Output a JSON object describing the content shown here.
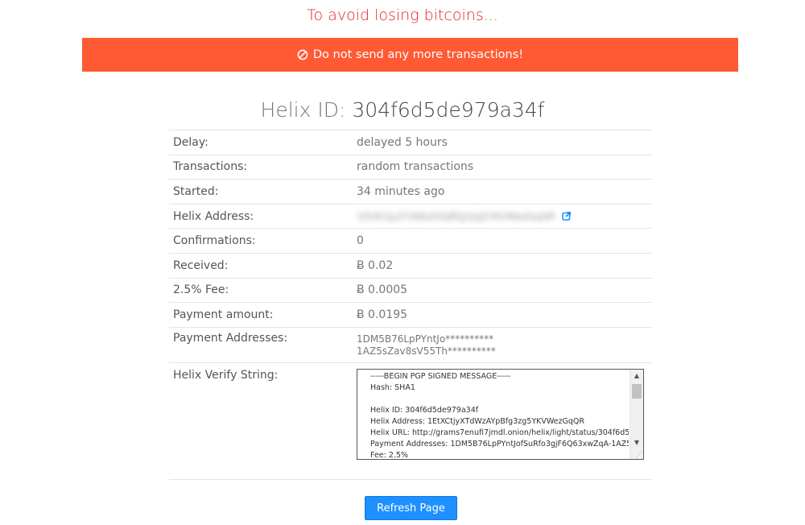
{
  "warning": "To avoid losing bitcoins...",
  "alert": "Do not send any more transactions!",
  "helix": {
    "label": "Helix ID:",
    "id": "304f6d5de979a34f"
  },
  "rows": [
    {
      "label": "Delay:",
      "value": "delayed 5 hours"
    },
    {
      "label": "Transactions:",
      "value": "random transactions"
    },
    {
      "label": "Started:",
      "value": "34 minutes ago"
    },
    {
      "label": "Helix Address:",
      "value": "1EtXCtjyXTdWzAYpBfg3zg5YKVWezGqQR"
    },
    {
      "label": "Confirmations:",
      "value": "0"
    },
    {
      "label": "Received:",
      "value": "Ƀ 0.02"
    },
    {
      "label": "2.5% Fee:",
      "value": "Ƀ 0.0005"
    },
    {
      "label": "Payment amount:",
      "value": "Ƀ 0.0195"
    }
  ],
  "payment_addresses": {
    "label": "Payment Addresses:",
    "lines": [
      "1DM5B76LpPYntJo**********",
      "1AZ5sZav8sV55Th**********"
    ]
  },
  "verify": {
    "label": "Helix Verify String:",
    "text": "-----BEGIN PGP SIGNED MESSAGE-----\nHash: SHA1\n\nHelix ID: 304f6d5de979a34f\nHelix Address: 1EtXCtjyXTdWzAYpBfg3zg5YKVWezGqQR\nHelix URL: http://grams7enufi7jmdl.onion/helix/light/status/304f6d5de\nPayment Addresses: 1DM5B76LpPYntJofSuRfo3gjF6Q63xwZqA-1AZ5\nFee: 2.5%"
  },
  "refresh_label": "Refresh Page",
  "colors": {
    "alert": "#ff5a33",
    "warning": "#e0241a",
    "button": "#1e90ff",
    "link_icon": "#1e90ff"
  }
}
